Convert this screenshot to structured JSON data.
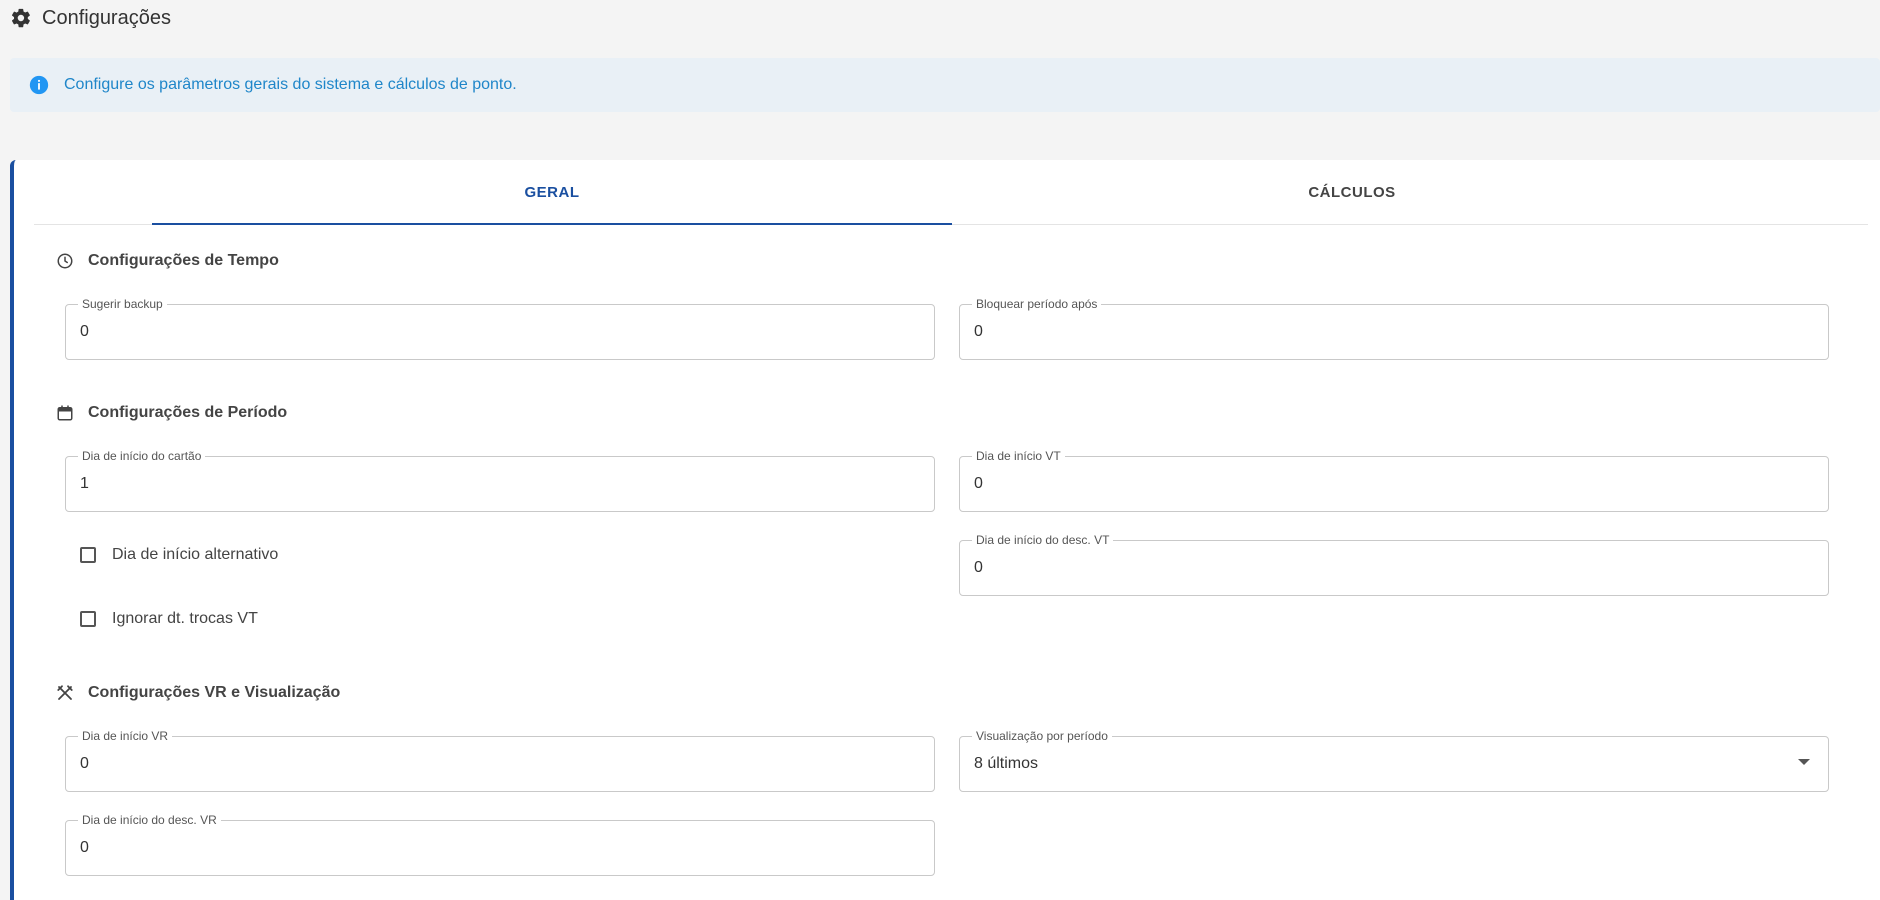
{
  "page": {
    "title": "Configurações",
    "icon": "gear-icon"
  },
  "info": {
    "icon": "info-icon",
    "message": "Configure os parâmetros gerais do sistema e cálculos de ponto.",
    "accent": "#1f86c9"
  },
  "tabs": [
    {
      "label": "GERAL",
      "active": true
    },
    {
      "label": "CÁLCULOS",
      "active": false
    }
  ],
  "sections": {
    "tempo": {
      "title": "Configurações de Tempo",
      "icon": "clock-icon",
      "sugerir_backup": {
        "label": "Sugerir backup",
        "value": "0"
      },
      "bloquear_periodo": {
        "label": "Bloquear período após",
        "value": "0"
      }
    },
    "periodo": {
      "title": "Configurações de Período",
      "icon": "calendar-icon",
      "dia_inicio_cartao": {
        "label": "Dia de início do cartão",
        "value": "1"
      },
      "dia_inicio_vt": {
        "label": "Dia de início VT",
        "value": "0"
      },
      "dia_inicio_desc_vt": {
        "label": "Dia de início do desc. VT",
        "value": "0"
      },
      "dia_inicio_alternativo": {
        "label": "Dia de início alternativo",
        "checked": false
      },
      "ignorar_trocas_vt": {
        "label": "Ignorar dt. trocas VT",
        "checked": false
      }
    },
    "vr": {
      "title": "Configurações VR e Visualização",
      "icon": "utensils-icon",
      "dia_inicio_vr": {
        "label": "Dia de início VR",
        "value": "0"
      },
      "visualizacao_periodo": {
        "label": "Visualização por período",
        "value": "8 últimos"
      },
      "dia_inicio_desc_vr": {
        "label": "Dia de início do desc. VR",
        "value": "0"
      }
    }
  },
  "colors": {
    "primary": "#1a4fa0",
    "background": "#f4f4f4",
    "banner": "#e9f0f6"
  }
}
